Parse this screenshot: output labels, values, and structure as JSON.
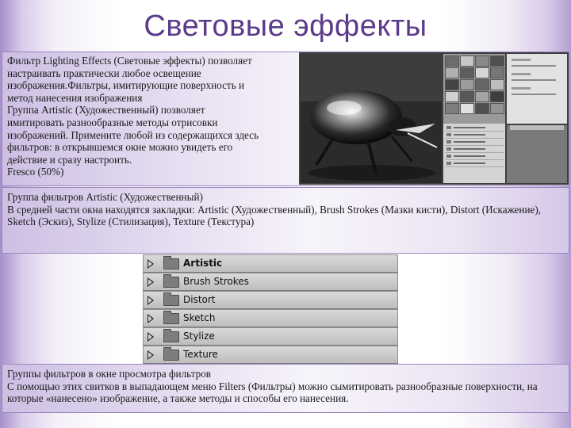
{
  "slide": {
    "title": "Световые эффекты",
    "section1": {
      "lines": [
        "Фильтр Lighting Effects (Световые эффекты) позволяет",
        "настраивать практически любое освещение",
        "изображения.Фильтры, имитирующие поверхность и",
        "метод нанесения изображения",
        "Группа Artistic (Художественный) позволяет",
        "имитировать разнообразные методы отрисовки",
        "изображений. Примените любой из содержащихся здесь",
        "фильтров: в открывшемся окне можно увидеть его",
        "действие и сразу настроить.",
        "Fresco (50%)"
      ]
    },
    "section2": {
      "heading": "Группа фильтров Artistic (Художественный)",
      "body": "В средней части окна находятся закладки: Artistic (Художественный), Brush Strokes (Мазки кисти), Distort (Искажение), Sketch (Эскиз), Stylize (Стилизация), Texture (Текстура)"
    },
    "folders": [
      {
        "label": "Artistic",
        "bold": true
      },
      {
        "label": "Brush Strokes",
        "bold": false
      },
      {
        "label": "Distort",
        "bold": false
      },
      {
        "label": "Sketch",
        "bold": false
      },
      {
        "label": "Stylize",
        "bold": false
      },
      {
        "label": "Texture",
        "bold": false
      }
    ],
    "section3": {
      "heading": "Группы фильтров в окне просмотра фильтров",
      "body": "С помощью этих свитков в выпадающем меню Filters (Фильтры) можно сымитировать разнообразные поверхности, на которые «нанесено» изображение, а также методы и способы его нанесения."
    }
  }
}
